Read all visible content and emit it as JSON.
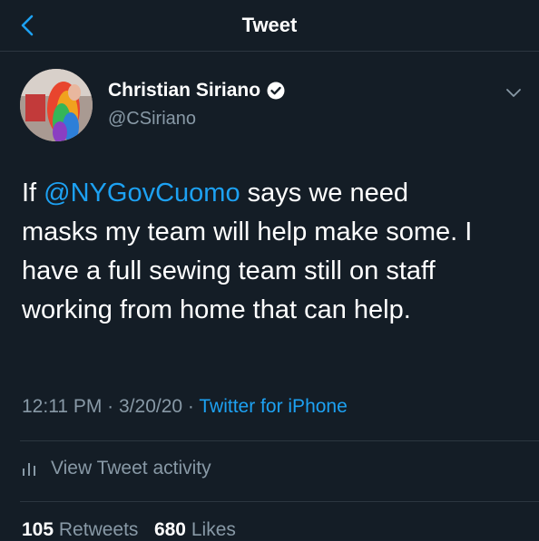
{
  "header": {
    "title": "Tweet",
    "back_icon": "chevron-left-icon"
  },
  "author": {
    "display_name": "Christian Siriano",
    "handle": "@CSiriano",
    "verified": true
  },
  "tweet": {
    "lines": [
      {
        "prefix": "If ",
        "mention": "@NYGovCuomo",
        "suffix": " says we need"
      },
      {
        "text": "masks my team will help make some. I"
      },
      {
        "text": "have a full sewing team still on staff"
      },
      {
        "text": "working from home that can help."
      }
    ]
  },
  "meta": {
    "time": "12:11 PM",
    "separator": " · ",
    "date": "3/20/20",
    "source": "Twitter for iPhone"
  },
  "activity": {
    "label": "View Tweet activity"
  },
  "stats": {
    "retweets_count": "105",
    "retweets_label": "Retweets",
    "likes_count": "680",
    "likes_label": "Likes"
  },
  "colors": {
    "background": "#141d26",
    "accent": "#1da1f2",
    "secondary_text": "#8899a6"
  }
}
